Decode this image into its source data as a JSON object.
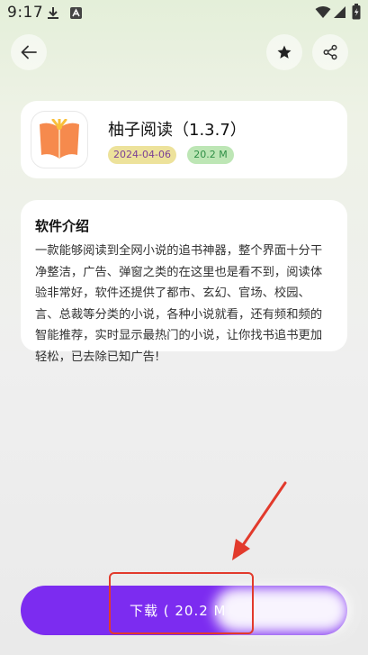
{
  "status_bar": {
    "time": "9:17"
  },
  "header": {
    "back_icon": "arrow-left-icon",
    "favorite_icon": "star-icon",
    "share_icon": "share-icon"
  },
  "app": {
    "name": "柚子阅读（1.3.7）",
    "date": "2024-04-06",
    "size": "20.2 M",
    "icon": "open-book-icon"
  },
  "intro": {
    "title": "软件介绍",
    "lines": [
      "一款能够阅读到全网小说的追书神器，整个界面十分干",
      "净整洁，广告、弹窗之类的在这里也是看不到，阅读体",
      "验非常好，软件还提供了都市、玄幻、官场、校园、",
      "言、总裁等分类的小说，各种小说就看，还有频和频的",
      "智能推荐，实时显示最热门的小说，让你找书追书更加",
      "轻松，已去除已知广告!"
    ]
  },
  "download": {
    "label": "下载 ( 20.2 M"
  },
  "colors": {
    "accent": "#7c2cf0",
    "annotation": "#e23a2c",
    "date_badge_bg": "#ede29b",
    "size_badge_bg": "#bde6b5"
  }
}
